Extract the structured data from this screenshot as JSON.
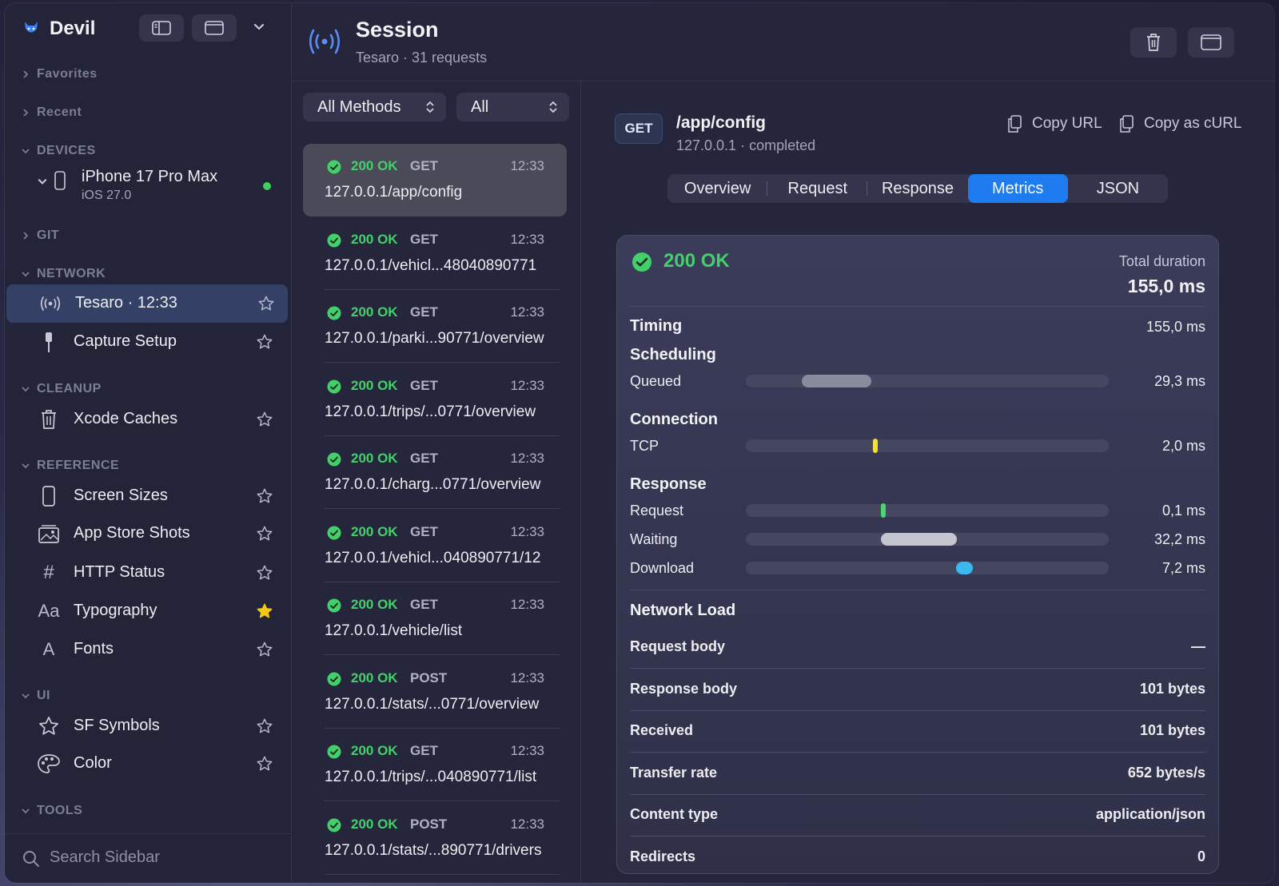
{
  "app": {
    "name": "Devil"
  },
  "sidebar": {
    "sections": {
      "favorites": "Favorites",
      "recent": "Recent",
      "devices": "DEVICES",
      "git": "GIT",
      "network": "NETWORK",
      "cleanup": "CLEANUP",
      "reference": "REFERENCE",
      "ui": "UI",
      "tools": "TOOLS"
    },
    "device": {
      "name": "iPhone 17 Pro Max",
      "os": "iOS 27.0",
      "status_color": "#3fcf62"
    },
    "items": [
      {
        "label": "Tesaro · 12:33",
        "icon": "broadcast-icon",
        "starred": false,
        "active": true
      },
      {
        "label": "Capture Setup",
        "icon": "cable-icon",
        "starred": false
      },
      {
        "label": "Xcode Caches",
        "icon": "trash-icon",
        "starred": false
      },
      {
        "label": "Screen Sizes",
        "icon": "phone-icon",
        "starred": false
      },
      {
        "label": "App Store Shots",
        "icon": "photos-icon",
        "starred": false
      },
      {
        "label": "HTTP Status",
        "icon": "hash-icon",
        "starred": false
      },
      {
        "label": "Typography",
        "icon": "text-aa-icon",
        "starred": true
      },
      {
        "label": "Fonts",
        "icon": "font-a-icon",
        "starred": false
      },
      {
        "label": "SF Symbols",
        "icon": "star-outline-icon",
        "starred": false
      },
      {
        "label": "Color",
        "icon": "palette-icon",
        "starred": false
      }
    ],
    "search_placeholder": "Search Sidebar"
  },
  "session": {
    "title": "Session",
    "subtitle": "Tesaro · 31 requests"
  },
  "filters": {
    "method": "All Methods",
    "status": "All"
  },
  "requests": [
    {
      "status": "200 OK",
      "method": "GET",
      "time": "12:33",
      "url": "127.0.0.1/app/config",
      "selected": true
    },
    {
      "status": "200 OK",
      "method": "GET",
      "time": "12:33",
      "url": "127.0.0.1/vehicl...48040890771"
    },
    {
      "status": "200 OK",
      "method": "GET",
      "time": "12:33",
      "url": "127.0.0.1/parki...90771/overview"
    },
    {
      "status": "200 OK",
      "method": "GET",
      "time": "12:33",
      "url": "127.0.0.1/trips/...0771/overview"
    },
    {
      "status": "200 OK",
      "method": "GET",
      "time": "12:33",
      "url": "127.0.0.1/charg...0771/overview"
    },
    {
      "status": "200 OK",
      "method": "GET",
      "time": "12:33",
      "url": "127.0.0.1/vehicl...040890771/12"
    },
    {
      "status": "200 OK",
      "method": "GET",
      "time": "12:33",
      "url": "127.0.0.1/vehicle/list"
    },
    {
      "status": "200 OK",
      "method": "POST",
      "time": "12:33",
      "url": "127.0.0.1/stats/...0771/overview"
    },
    {
      "status": "200 OK",
      "method": "GET",
      "time": "12:33",
      "url": "127.0.0.1/trips/...040890771/list"
    },
    {
      "status": "200 OK",
      "method": "POST",
      "time": "12:33",
      "url": "127.0.0.1/stats/...890771/drivers"
    }
  ],
  "detail": {
    "method": "GET",
    "path": "/app/config",
    "subtitle": "127.0.0.1 · completed",
    "copy_url": "Copy URL",
    "copy_curl": "Copy as cURL",
    "tabs": [
      "Overview",
      "Request",
      "Response",
      "Metrics",
      "JSON"
    ],
    "active_tab": "Metrics",
    "metrics": {
      "status": "200 OK",
      "total_label": "Total duration",
      "total_value": "155,0 ms",
      "timing_label": "Timing",
      "timing_value": "155,0 ms",
      "scheduling_label": "Scheduling",
      "connection_label": "Connection",
      "response_label": "Response",
      "bars": {
        "queued": {
          "label": "Queued",
          "value": "29,3 ms",
          "start": 0.155,
          "length": 0.19,
          "color": "#8a8b9c"
        },
        "tcp": {
          "label": "TCP",
          "value": "2,0 ms",
          "start": 0.35,
          "length": 0.013,
          "color": "#f2e03a"
        },
        "request": {
          "label": "Request",
          "value": "0,1 ms",
          "start": 0.373,
          "length": 0.008,
          "color": "#4ad86e"
        },
        "waiting": {
          "label": "Waiting",
          "value": "32,2 ms",
          "start": 0.373,
          "length": 0.208,
          "color": "#c4c5d0"
        },
        "download": {
          "label": "Download",
          "value": "7,2 ms",
          "start": 0.58,
          "length": 0.046,
          "color": "#3ab8f0"
        }
      },
      "network_load_label": "Network Load",
      "load_rows": [
        {
          "label": "Request body",
          "value": "—"
        },
        {
          "label": "Response body",
          "value": "101 bytes"
        },
        {
          "label": "Received",
          "value": "101 bytes"
        },
        {
          "label": "Transfer rate",
          "value": "652 bytes/s"
        },
        {
          "label": "Content type",
          "value": "application/json"
        },
        {
          "label": "Redirects",
          "value": "0"
        }
      ]
    }
  },
  "colors": {
    "accent": "#1e7cf0",
    "success": "#43d06a",
    "star": "#f5c518"
  }
}
